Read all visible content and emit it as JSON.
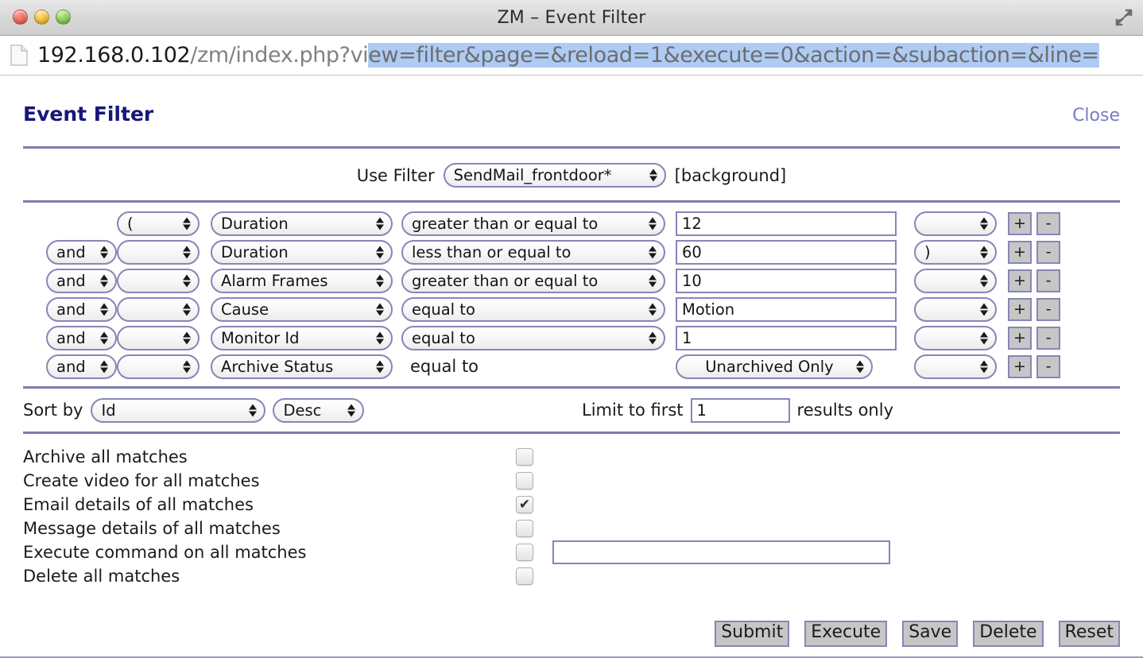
{
  "window": {
    "title": "ZM – Event Filter",
    "controls": [
      "close",
      "minimize",
      "zoom"
    ],
    "expand_icon": "fullscreen-arrows-icon"
  },
  "urlbar": {
    "icon": "page-document-icon",
    "host": "192.168.0.102",
    "path": "/zm/index.php?vi",
    "selected": "ew=filter&page=&reload=1&execute=0&action=&subaction=&line=",
    "full": "192.168.0.102/zm/index.php?view=filter&page=&reload=1&execute=0&action=&subaction=&line="
  },
  "page": {
    "title": "Event Filter",
    "close_label": "Close"
  },
  "use_filter": {
    "label": "Use Filter",
    "selected": "SendMail_frontdoor*",
    "background_tag": "[background]"
  },
  "filter_rows": [
    {
      "conj": "",
      "open_bracket": "(",
      "attribute": "Duration",
      "operator": "greater than or equal to",
      "value": "12",
      "value_type": "text",
      "close_bracket": "",
      "add_label": "+",
      "remove_label": "-"
    },
    {
      "conj": "and",
      "open_bracket": "",
      "attribute": "Duration",
      "operator": "less than or equal to",
      "value": "60",
      "value_type": "text",
      "close_bracket": ")",
      "add_label": "+",
      "remove_label": "-"
    },
    {
      "conj": "and",
      "open_bracket": "",
      "attribute": "Alarm Frames",
      "operator": "greater than or equal to",
      "value": "10",
      "value_type": "text",
      "close_bracket": "",
      "add_label": "+",
      "remove_label": "-"
    },
    {
      "conj": "and",
      "open_bracket": "",
      "attribute": "Cause",
      "operator": "equal to",
      "value": "Motion",
      "value_type": "text",
      "close_bracket": "",
      "add_label": "+",
      "remove_label": "-"
    },
    {
      "conj": "and",
      "open_bracket": "",
      "attribute": "Monitor Id",
      "operator": "equal to",
      "value": "1",
      "value_type": "text",
      "close_bracket": "",
      "add_label": "+",
      "remove_label": "-"
    },
    {
      "conj": "and",
      "open_bracket": "",
      "attribute": "Archive Status",
      "operator": "equal to",
      "operator_type": "static",
      "value": "Unarchived Only",
      "value_type": "select",
      "close_bracket": "",
      "add_label": "+",
      "remove_label": "-"
    }
  ],
  "sort": {
    "label": "Sort by",
    "field": "Id",
    "direction": "Desc",
    "limit_prefix": "Limit to first",
    "limit_value": "1",
    "limit_suffix": "results only"
  },
  "actions": [
    {
      "label": "Archive all matches",
      "checked": false
    },
    {
      "label": "Create video for all matches",
      "checked": false
    },
    {
      "label": "Email details of all matches",
      "checked": true
    },
    {
      "label": "Message details of all matches",
      "checked": false
    },
    {
      "label": "Execute command on all matches",
      "checked": false,
      "command_value": ""
    },
    {
      "label": "Delete all matches",
      "checked": false
    }
  ],
  "footer_buttons": [
    {
      "label": "Submit"
    },
    {
      "label": "Execute"
    },
    {
      "label": "Save"
    },
    {
      "label": "Delete"
    },
    {
      "label": "Reset"
    }
  ],
  "colors": {
    "accent_border": "#8686b8",
    "rule": "#7d7daf",
    "title_blue": "#16167a",
    "link": "#7b7bc4",
    "selection": "#aecbf4",
    "button_face": "#c6c6c6"
  }
}
